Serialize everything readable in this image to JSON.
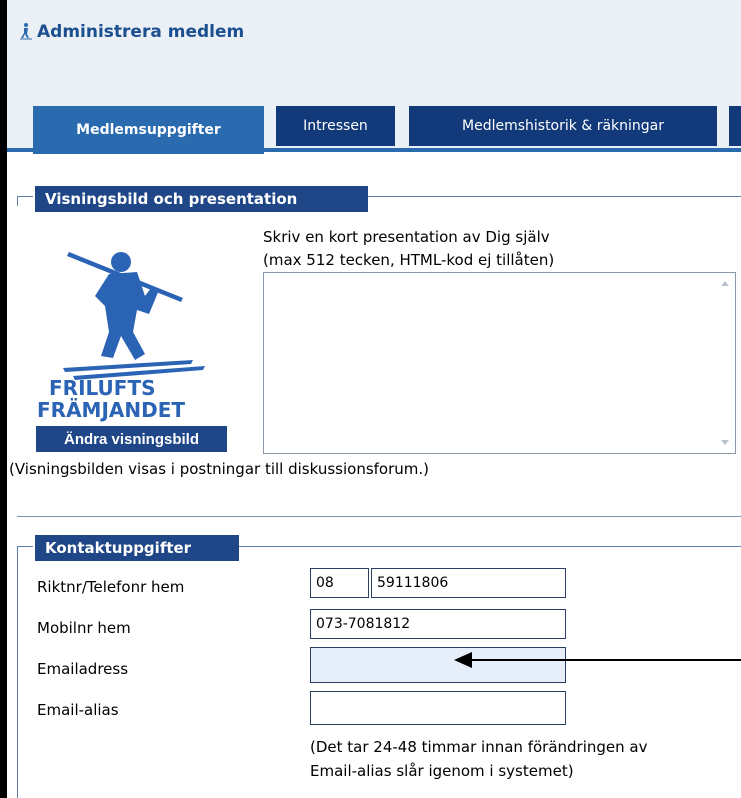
{
  "window": {
    "title": "Administrera medlem",
    "title_icon": "skier-icon"
  },
  "tabs": [
    {
      "label": "Medlemsuppgifter",
      "active": true
    },
    {
      "label": "Intressen",
      "active": false
    },
    {
      "label": "Medlemshistorik & räkningar",
      "active": false
    }
  ],
  "presentation": {
    "legend": "Visningsbild och presentation",
    "instruction_line1": "Skriv en kort presentation av Dig själv",
    "instruction_line2": "(max 512 tecken, HTML-kod ej tillåten)",
    "textarea_value": "",
    "logo_line1": "FRILUFTS",
    "logo_line2": "FRÄMJANDET",
    "change_image_label": "Ändra visningsbild",
    "note": "(Visningsbilden visas i postningar till diskussionsforum.)"
  },
  "contact": {
    "legend": "Kontaktuppgifter",
    "phone_label": "Riktnr/Telefonr hem",
    "area_code": "08",
    "phone_number": "59111806",
    "mobile_label": "Mobilnr hem",
    "mobile_value": "073-7081812",
    "email_label": "Emailadress",
    "email_value": "",
    "alias_label": "Email-alias",
    "alias_value": "",
    "alias_note_line1": "(Det tar 24-48 timmar innan förändringen av",
    "alias_note_line2": "Email-alias slår igenom i systemet)"
  },
  "colors": {
    "accent": "#1f4687",
    "tab_active": "#2a6bb0",
    "header_bg": "#eaf0f5",
    "disabled_input": "#e5eef9"
  }
}
